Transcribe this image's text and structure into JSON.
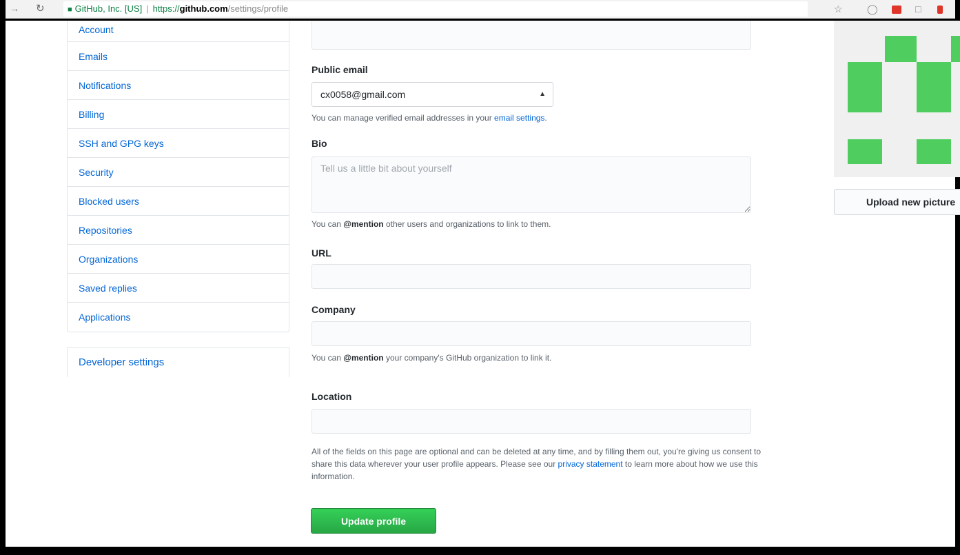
{
  "browser": {
    "secure_label": "GitHub, Inc. [US]",
    "url_scheme": "https://",
    "url_host": "github.com",
    "url_path": "/settings/profile"
  },
  "sidebar": {
    "items": [
      {
        "label": "Account"
      },
      {
        "label": "Emails"
      },
      {
        "label": "Notifications"
      },
      {
        "label": "Billing"
      },
      {
        "label": "SSH and GPG keys"
      },
      {
        "label": "Security"
      },
      {
        "label": "Blocked users"
      },
      {
        "label": "Repositories"
      },
      {
        "label": "Organizations"
      },
      {
        "label": "Saved replies"
      },
      {
        "label": "Applications"
      }
    ],
    "developer_settings": "Developer settings"
  },
  "form": {
    "public_email": {
      "label": "Public email",
      "selected": "cx0058@gmail.com",
      "note_prefix": "You can manage verified email addresses in your ",
      "note_link": "email settings",
      "note_suffix": "."
    },
    "bio": {
      "label": "Bio",
      "placeholder": "Tell us a little bit about yourself",
      "note_prefix": "You can ",
      "note_mention": "@mention",
      "note_suffix": " other users and organizations to link to them."
    },
    "url": {
      "label": "URL",
      "value": ""
    },
    "company": {
      "label": "Company",
      "value": "",
      "note_prefix": "You can ",
      "note_mention": "@mention",
      "note_suffix": " your company's GitHub organization to link it."
    },
    "location": {
      "label": "Location",
      "value": ""
    },
    "disclaimer": {
      "prefix": "All of the fields on this page are optional and can be deleted at any time, and by filling them out, you're giving us consent to share this data wherever your user profile appears. Please see our ",
      "link": "privacy statement",
      "suffix": " to learn more about how we use this information."
    },
    "update_button": "Update profile"
  },
  "avatar_panel": {
    "upload_button": "Upload new picture",
    "accent_color": "#4fcd5f"
  },
  "icons": [
    "back-arrow-icon",
    "reload-icon",
    "lock-icon",
    "star-icon",
    "extension-icon",
    "select-arrow-icon"
  ]
}
